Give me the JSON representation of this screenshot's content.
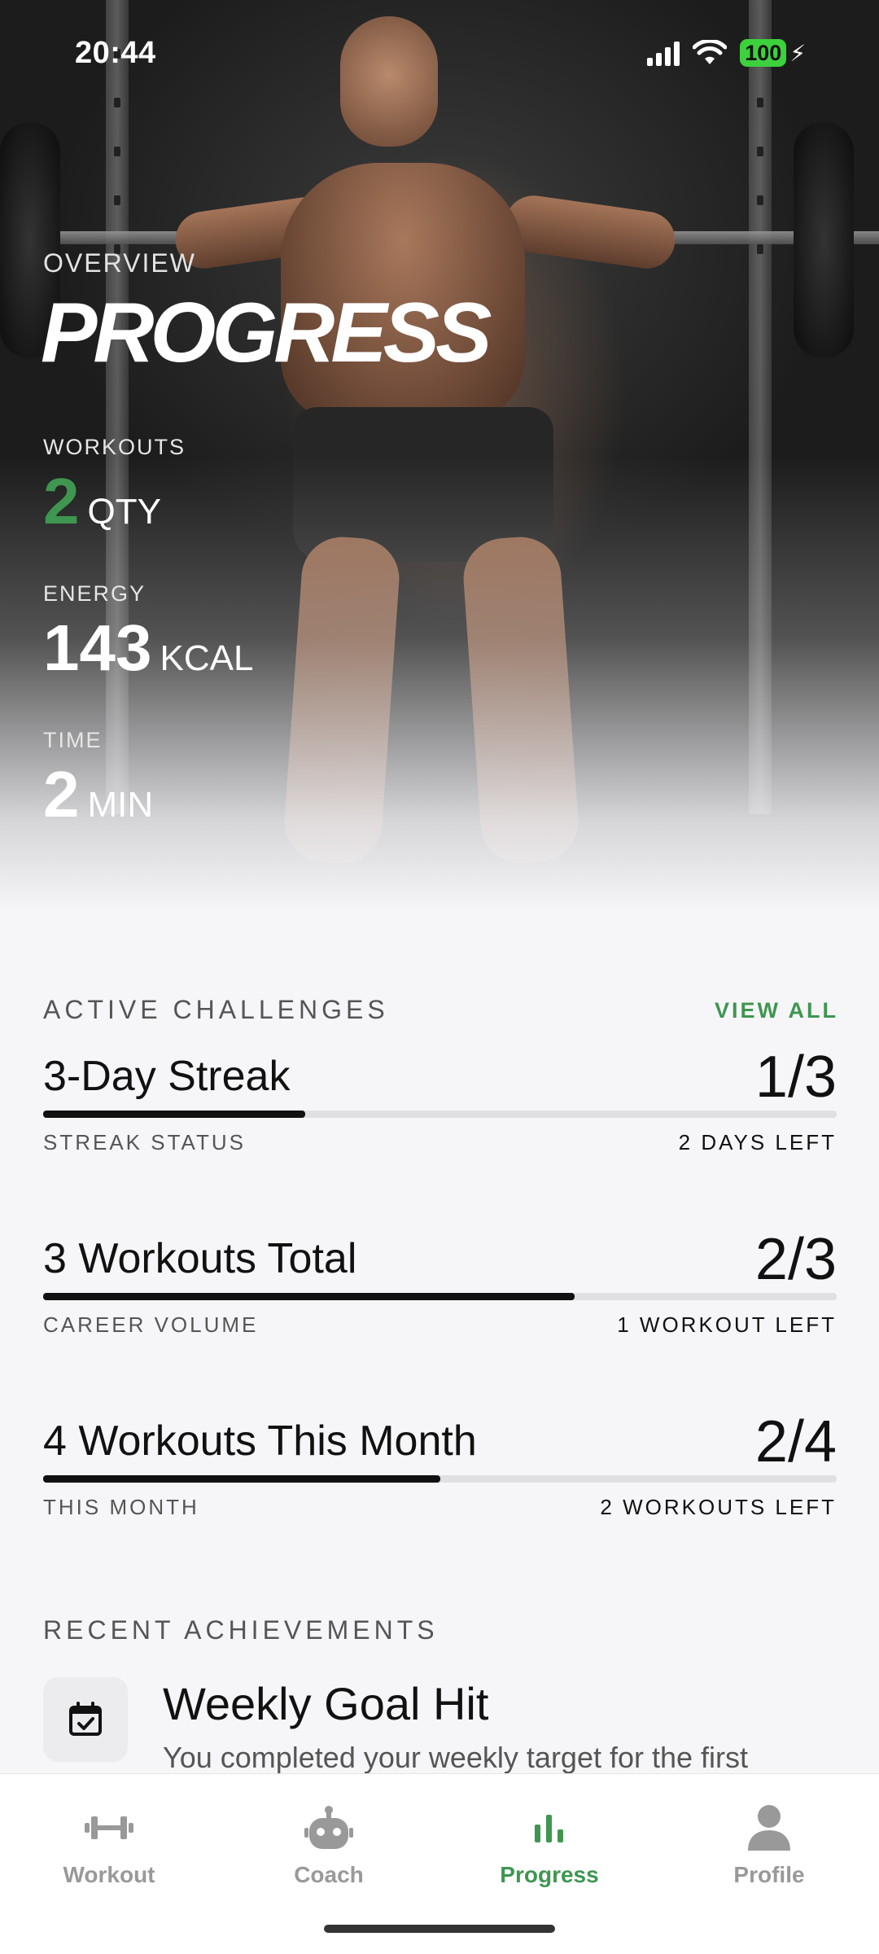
{
  "status_bar": {
    "time": "20:44",
    "battery_level": "100",
    "icons": [
      "signal-icon",
      "wifi-icon",
      "battery-charging-icon"
    ]
  },
  "hero": {
    "overline": "OVERVIEW",
    "title": "PROGRESS",
    "stats": [
      {
        "label": "WORKOUTS",
        "value": "2",
        "unit": "QTY",
        "accent": "#3e9650"
      },
      {
        "label": "ENERGY",
        "value": "143",
        "unit": "KCAL"
      },
      {
        "label": "TIME",
        "value": "2",
        "unit": "MIN"
      }
    ]
  },
  "challenges": {
    "heading": "ACTIVE CHALLENGES",
    "view_all": "VIEW ALL",
    "items": [
      {
        "name": "3-Day Streak",
        "ratio": "1/3",
        "progress": 0.33,
        "subtitle": "STREAK STATUS",
        "remaining": "2 DAYS LEFT"
      },
      {
        "name": "3 Workouts Total",
        "ratio": "2/3",
        "progress": 0.67,
        "subtitle": "CAREER VOLUME",
        "remaining": "1 WORKOUT LEFT"
      },
      {
        "name": "4 Workouts This Month",
        "ratio": "2/4",
        "progress": 0.5,
        "subtitle": "THIS MONTH",
        "remaining": "2 WORKOUTS LEFT"
      }
    ]
  },
  "achievements": {
    "heading": "RECENT ACHIEVEMENTS",
    "items": [
      {
        "icon": "calendar-check-icon",
        "title": "Weekly Goal Hit",
        "description": "You completed your weekly target for the first"
      }
    ]
  },
  "tabbar": {
    "tabs": [
      {
        "label": "Workout",
        "icon": "dumbbell-icon",
        "active": false
      },
      {
        "label": "Coach",
        "icon": "robot-icon",
        "active": false
      },
      {
        "label": "Progress",
        "icon": "bar-chart-icon",
        "active": true
      },
      {
        "label": "Profile",
        "icon": "person-icon",
        "active": false
      }
    ]
  },
  "colors": {
    "accent": "#3e9650",
    "background": "#f6f6f9",
    "progress_fill": "#111111",
    "progress_track": "#e0e0e3",
    "battery": "#3dd13d"
  }
}
